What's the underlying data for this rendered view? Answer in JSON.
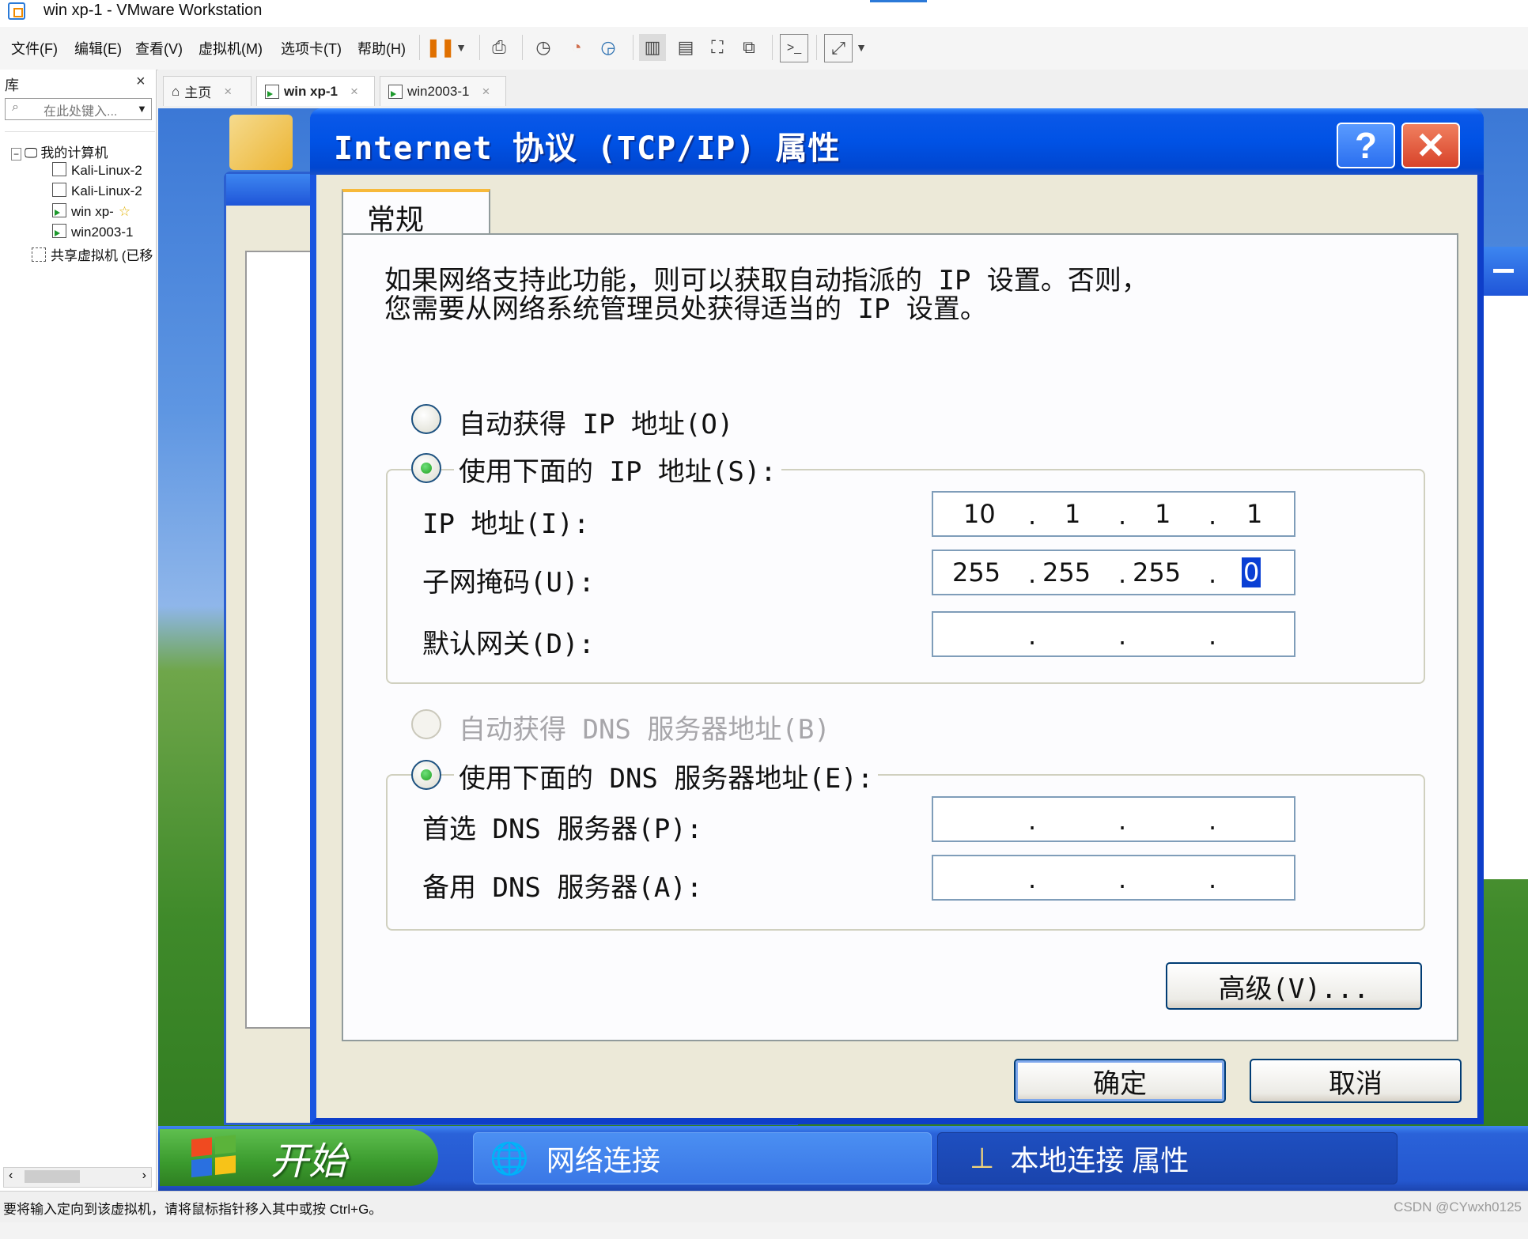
{
  "host": {
    "window_title": "win xp-1 - VMware Workstation",
    "menu": [
      "文件(F)",
      "编辑(E)",
      "查看(V)",
      "虚拟机(M)",
      "选项卡(T)",
      "帮助(H)"
    ],
    "library": {
      "title": "库",
      "search_placeholder": "在此处键入...",
      "tree": {
        "root": "我的计算机",
        "vms": [
          "Kali-Linux-2",
          "Kali-Linux-2",
          "win xp-",
          "win2003-1"
        ],
        "shared": "共享虚拟机 (已移"
      }
    },
    "tabs": [
      "主页",
      "win xp-1",
      "win2003-1"
    ],
    "status_message": "要将输入定向到该虚拟机，请将鼠标指针移入其中或按 Ctrl+G。",
    "watermark": "CSDN @CYwxh0125"
  },
  "dialog": {
    "title": "Internet 协议 (TCP/IP) 属性",
    "tab": "常规",
    "intro_line1": "如果网络支持此功能，则可以获取自动指派的 IP 设置。否则，",
    "intro_line2": "您需要从网络系统管理员处获得适当的 IP 设置。",
    "radio_auto_ip": "自动获得 IP 地址(O)",
    "radio_manual_ip": "使用下面的 IP 地址(S):",
    "ip_label": "IP 地址(I):",
    "ip_value": [
      "10",
      "1",
      "1",
      "1"
    ],
    "mask_label": "子网掩码(U):",
    "mask_value": [
      "255",
      "255",
      "255",
      "0"
    ],
    "gateway_label": "默认网关(D):",
    "radio_auto_dns": "自动获得 DNS 服务器地址(B)",
    "radio_manual_dns": "使用下面的 DNS 服务器地址(E):",
    "dns1_label": "首选 DNS 服务器(P):",
    "dns2_label": "备用 DNS 服务器(A):",
    "advanced_button": "高级(V)...",
    "ok_button": "确定",
    "cancel_button": "取消",
    "help_glyph": "?",
    "close_glyph": "✕"
  },
  "guest_taskbar": {
    "start": "开始",
    "items": [
      "网络连接",
      "本地连接 属性"
    ]
  },
  "colors": {
    "xp_title_blue": "#0052e5",
    "dialog_face": "#ece9d8",
    "start_green": "#3a9a2d"
  }
}
